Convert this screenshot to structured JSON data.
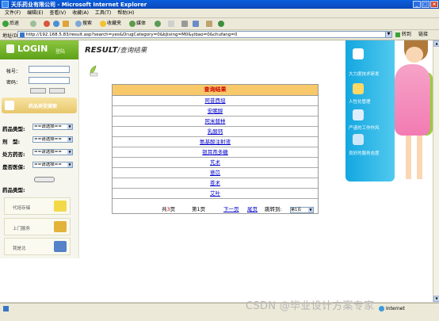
{
  "window": {
    "title": "天乐药业有限公司 - Microsoft Internet Explorer"
  },
  "menu": [
    "文件(F)",
    "编辑(E)",
    "查看(V)",
    "收藏(A)",
    "工具(T)",
    "帮助(H)"
  ],
  "toolbar": {
    "back": "后退",
    "search": "搜索",
    "favorites": "收藏夹",
    "media": "媒体"
  },
  "address": {
    "label": "地址(D)",
    "url": "http://192.168.5.83/result.asp?search=yes&DrugCategory=0&bJixing=M0&yibao=0&chufang=0",
    "go": "转到",
    "links": "链接"
  },
  "login": {
    "title": "LOGIN",
    "subtitle": "登陆",
    "username_label": "帐号：",
    "password_label": "密码："
  },
  "category_search": {
    "label": "药品类型搜索"
  },
  "filters": [
    {
      "label": "药品类型:",
      "value": "==请选择=="
    },
    {
      "label": "剂　型:",
      "value": "==请选择=="
    },
    {
      "label": "处方药否:",
      "value": "==请选择=="
    },
    {
      "label": "是否医保:",
      "value": "==请选择=="
    }
  ],
  "filter_extra_label": "药品类型:",
  "services": [
    "代培存储",
    "上门服务",
    "我是北"
  ],
  "main": {
    "title": "RESULT",
    "subtitle": "/查询结果"
  },
  "results": {
    "header": "查询结果",
    "items": [
      "阿昔西坦",
      "安眠醇",
      "阿米替林",
      "乳酸钙",
      "氨基酸注射液",
      "银耳孢多糖",
      "艽术",
      "薏苡",
      "苍术",
      "艾叶"
    ]
  },
  "pager": {
    "total_prefix": "共",
    "total_pages": "3",
    "total_suffix": "页",
    "current": "第1页",
    "next": "下一页",
    "last": "尾页",
    "jump_label": "跳转到:",
    "jump_value": "第1页"
  },
  "right_panel": {
    "links": [
      "大力度技术研发",
      "人性化管理",
      "严谨的工作作风",
      "良好的服务态度"
    ]
  },
  "status": {
    "zone": "Internet"
  },
  "watermark": "CSDN @毕业设计方案专家",
  "colors": {
    "results_header_bg": "#f7c96a",
    "results_header_text": "#cc0000",
    "link": "#0000cc",
    "login_green": "#5da11a",
    "right_blue": "#13a7e0"
  }
}
